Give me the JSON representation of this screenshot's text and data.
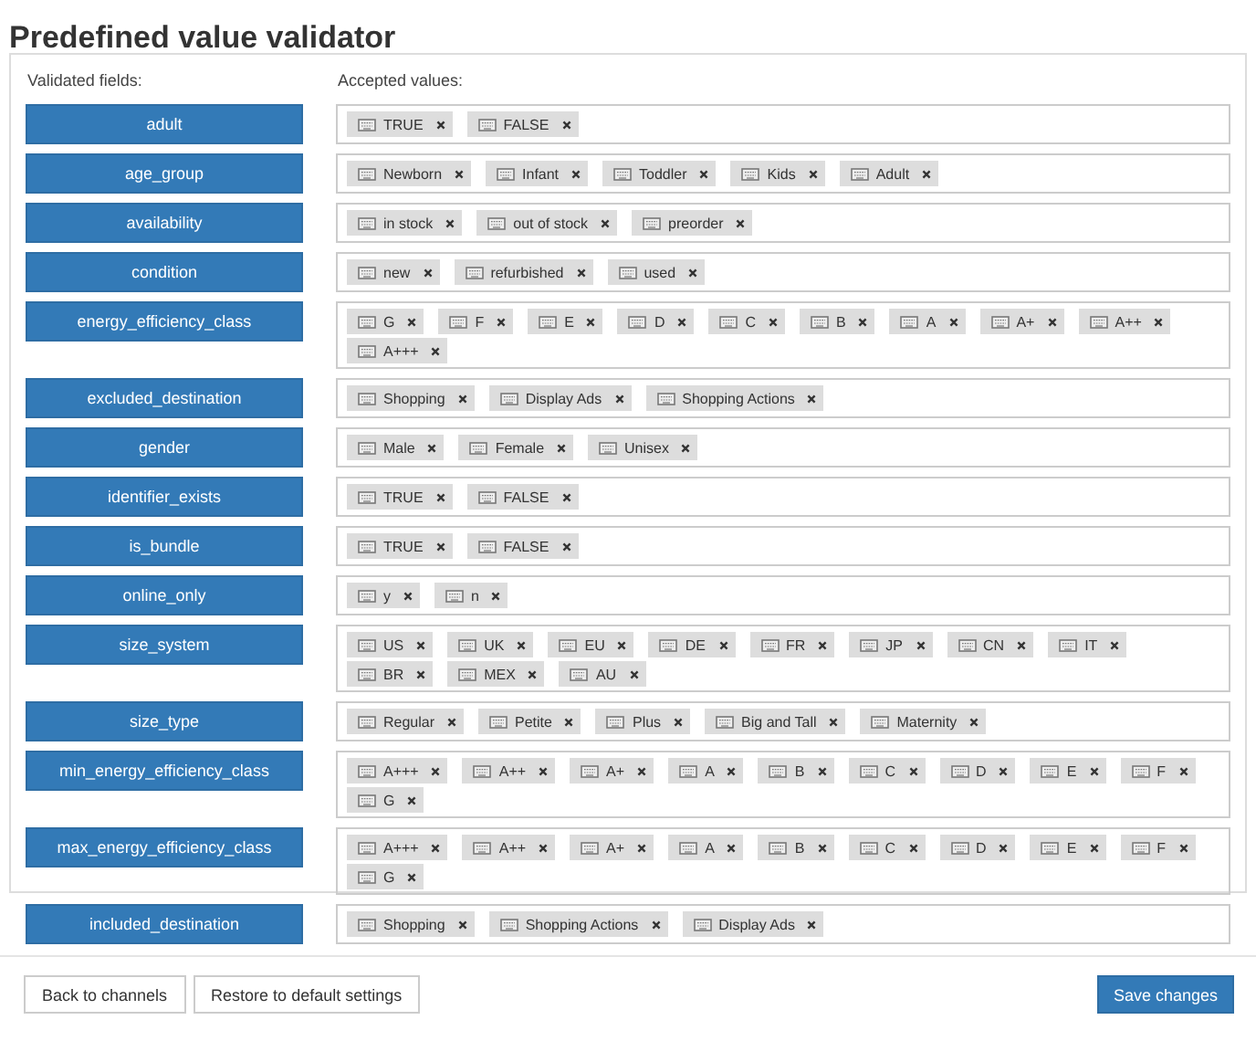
{
  "title": "Predefined value validator",
  "headers": {
    "fields": "Validated fields:",
    "values": "Accepted values:"
  },
  "rows": [
    {
      "field": "adult",
      "values": [
        "TRUE",
        "FALSE"
      ]
    },
    {
      "field": "age_group",
      "values": [
        "Newborn",
        "Infant",
        "Toddler",
        "Kids",
        "Adult"
      ]
    },
    {
      "field": "availability",
      "values": [
        "in stock",
        "out of stock",
        "preorder"
      ]
    },
    {
      "field": "condition",
      "values": [
        "new",
        "refurbished",
        "used"
      ]
    },
    {
      "field": "energy_efficiency_class",
      "values": [
        "G",
        "F",
        "E",
        "D",
        "C",
        "B",
        "A",
        "A+",
        "A++",
        "A+++"
      ]
    },
    {
      "field": "excluded_destination",
      "values": [
        "Shopping",
        "Display Ads",
        "Shopping Actions"
      ]
    },
    {
      "field": "gender",
      "values": [
        "Male",
        "Female",
        "Unisex"
      ]
    },
    {
      "field": "identifier_exists",
      "values": [
        "TRUE",
        "FALSE"
      ]
    },
    {
      "field": "is_bundle",
      "values": [
        "TRUE",
        "FALSE"
      ]
    },
    {
      "field": "online_only",
      "values": [
        "y",
        "n"
      ]
    },
    {
      "field": "size_system",
      "values": [
        "US",
        "UK",
        "EU",
        "DE",
        "FR",
        "JP",
        "CN",
        "IT",
        "BR",
        "MEX",
        "AU"
      ]
    },
    {
      "field": "size_type",
      "values": [
        "Regular",
        "Petite",
        "Plus",
        "Big and Tall",
        "Maternity"
      ]
    },
    {
      "field": "min_energy_efficiency_class",
      "values": [
        "A+++",
        "A++",
        "A+",
        "A",
        "B",
        "C",
        "D",
        "E",
        "F",
        "G"
      ]
    },
    {
      "field": "max_energy_efficiency_class",
      "values": [
        "A+++",
        "A++",
        "A+",
        "A",
        "B",
        "C",
        "D",
        "E",
        "F",
        "G"
      ]
    },
    {
      "field": "included_destination",
      "values": [
        "Shopping",
        "Shopping Actions",
        "Display Ads"
      ]
    }
  ],
  "footer": {
    "left_buttons": [
      "Back to channels",
      "Restore to default settings"
    ],
    "primary_button": "Save changes"
  }
}
